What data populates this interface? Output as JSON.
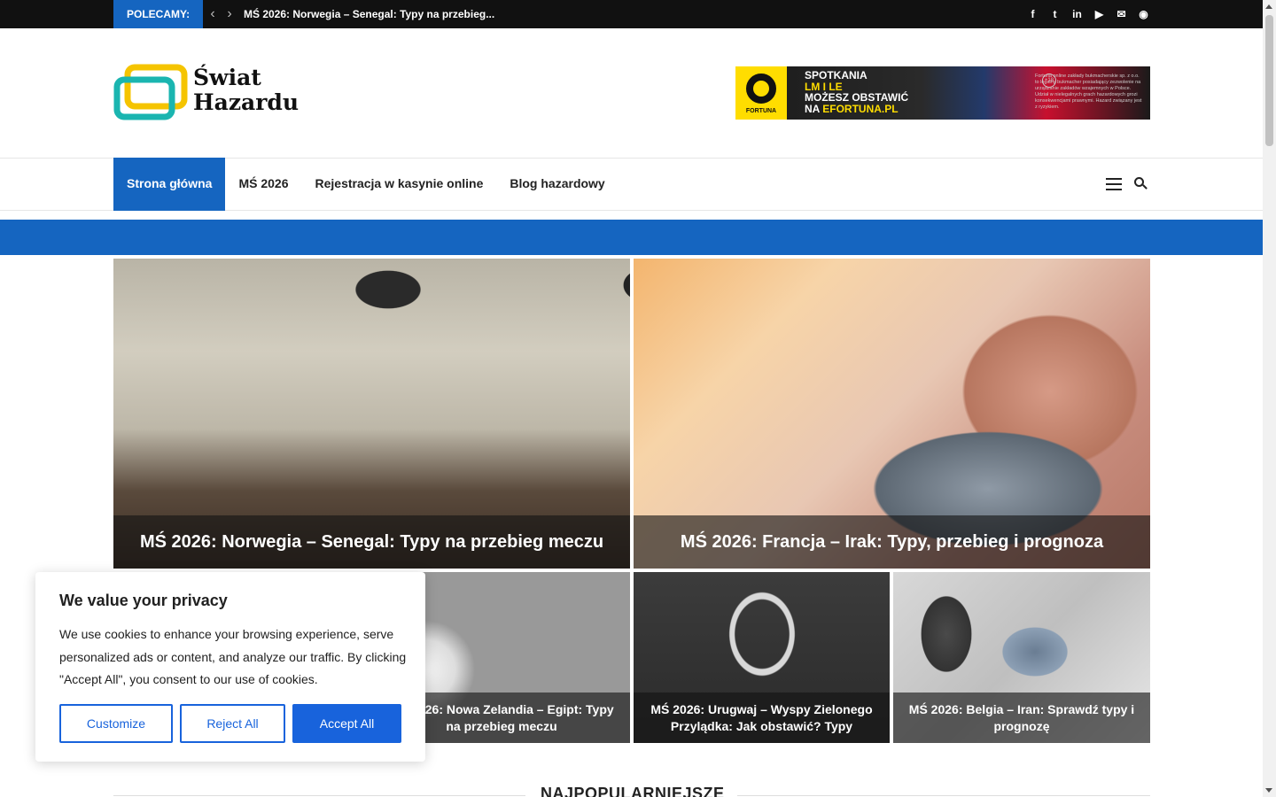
{
  "topbar": {
    "label": "POLECAMY:",
    "prev_icon": "chevron-left-icon",
    "next_icon": "chevron-right-icon",
    "ticker_text": "MŚ 2026: Norwegia – Senegal: Typy na przebieg...",
    "social": [
      {
        "name": "facebook-icon",
        "glyph": "f"
      },
      {
        "name": "twitter-icon",
        "glyph": "t"
      },
      {
        "name": "linkedin-icon",
        "glyph": "in"
      },
      {
        "name": "youtube-icon",
        "glyph": "▶"
      },
      {
        "name": "mail-icon",
        "glyph": "✉"
      },
      {
        "name": "rss-icon",
        "glyph": "◉"
      }
    ]
  },
  "header": {
    "logo_line1": "Świat",
    "logo_line2": "Hazardu",
    "ad": {
      "brand": "FORTUNA",
      "line1": "SPOTKANIA",
      "line2": "LM I LE",
      "line3": "MOŻESZ OBSTAWIĆ",
      "line4a": "NA ",
      "line4b": "EFORTUNA.PL",
      "badge": "+18",
      "disclaimer": "Fortuna online zakłady bukmacherskie sp. z o.o. to legalny bukmacher posiadający zezwolenie na urządzanie zakładów wzajemnych w Polsce. Udział w nielegalnych grach hazardowych grozi konsekwencjami prawnymi. Hazard związany jest z ryzykiem."
    }
  },
  "nav": {
    "items": [
      "Strona główna",
      "MŚ 2026",
      "Rejestracja w kasynie online",
      "Blog hazardowy"
    ],
    "active_index": 0,
    "menu_icon": "hamburger-menu-icon",
    "search_icon": "search-icon"
  },
  "featured": {
    "big": [
      {
        "title": "MŚ 2026: Norwegia – Senegal: Typy na przebieg meczu"
      },
      {
        "title": "MŚ 2026: Francja – Irak: Typy, przebieg i prognoza"
      }
    ],
    "small": [
      {
        "title": "MŚ 2026: Nowa Zelandia – Egipt: Typy na przebieg meczu"
      },
      {
        "title": "MŚ 2026: Urugwaj – Wyspy Zielonego Przylądka: Jak obstawić? Typy"
      },
      {
        "title": "MŚ 2026: Belgia – Iran: Sprawdź typy i prognozę"
      }
    ]
  },
  "section": {
    "title": "NAJPOPULARNIEJSZE"
  },
  "cookie": {
    "title": "We value your privacy",
    "body": "We use cookies to enhance your browsing experience, serve personalized ads or content, and analyze our traffic. By clicking \"Accept All\", you consent to our use of cookies.",
    "customize": "Customize",
    "reject": "Reject All",
    "accept": "Accept All"
  },
  "colors": {
    "accent": "#1565c0",
    "cookie_button": "#1863dc",
    "topbar_bg": "#111111"
  }
}
